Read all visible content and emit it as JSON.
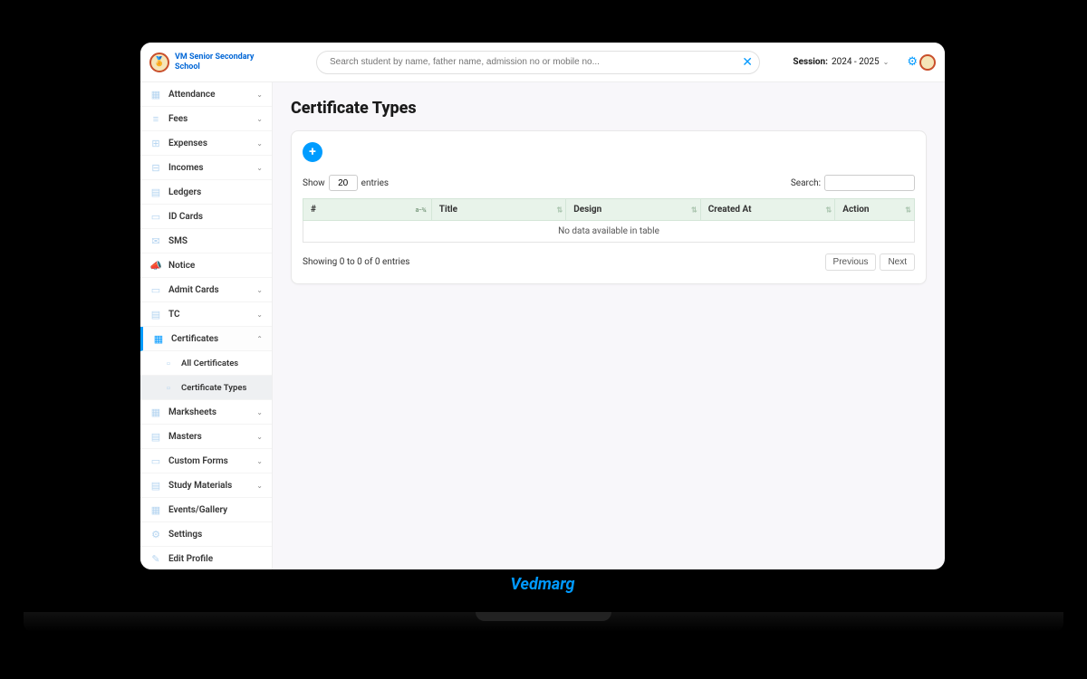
{
  "brand": {
    "school_name": "VM Senior Secondary School",
    "laptop_brand": "Vedmarg"
  },
  "header": {
    "search_placeholder": "Search student by name, father name, admission no or mobile no...",
    "session_label": "Session:",
    "session_value": "2024 - 2025"
  },
  "sidebar": {
    "items": [
      {
        "label": "Attendance",
        "chevron": true
      },
      {
        "label": "Fees",
        "chevron": true
      },
      {
        "label": "Expenses",
        "chevron": true
      },
      {
        "label": "Incomes",
        "chevron": true
      },
      {
        "label": "Ledgers",
        "chevron": false
      },
      {
        "label": "ID Cards",
        "chevron": false
      },
      {
        "label": "SMS",
        "chevron": false
      },
      {
        "label": "Notice",
        "chevron": false
      },
      {
        "label": "Admit Cards",
        "chevron": true
      },
      {
        "label": "TC",
        "chevron": true
      },
      {
        "label": "Certificates",
        "chevron": true,
        "active": true,
        "expanded": true
      },
      {
        "label": "Marksheets",
        "chevron": true
      },
      {
        "label": "Masters",
        "chevron": true
      },
      {
        "label": "Custom Forms",
        "chevron": true
      },
      {
        "label": "Study Materials",
        "chevron": true
      },
      {
        "label": "Events/Gallery",
        "chevron": false
      },
      {
        "label": "Settings",
        "chevron": false
      },
      {
        "label": "Edit Profile",
        "chevron": false
      }
    ],
    "certificates_sub": [
      {
        "label": "All Certificates"
      },
      {
        "label": "Certificate Types",
        "active": true
      }
    ]
  },
  "page": {
    "title": "Certificate Types"
  },
  "table": {
    "show_prefix": "Show",
    "show_value": "20",
    "show_suffix": "entries",
    "search_label": "Search:",
    "columns": [
      "#",
      "Title",
      "Design",
      "Created At",
      "Action"
    ],
    "empty_message": "No data available in table",
    "info": "Showing 0 to 0 of 0 entries",
    "prev": "Previous",
    "next": "Next"
  }
}
